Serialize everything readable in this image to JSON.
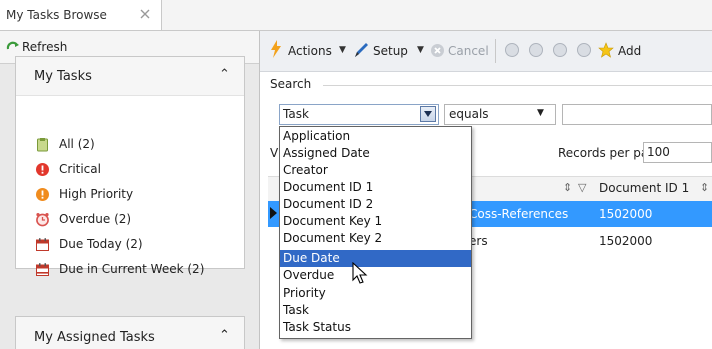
{
  "tab": {
    "title": "My Tasks Browse",
    "close_icon": "close-icon"
  },
  "left_panel": {
    "refresh_label": "Refresh",
    "my_tasks": {
      "title": "My Tasks",
      "collapse_glyph": "˄˄",
      "items": [
        {
          "label": "All (2)",
          "icon": "clipboard-icon",
          "color": "#9bbf5a"
        },
        {
          "label": "Critical",
          "icon": "critical-icon",
          "color": "#e2372c"
        },
        {
          "label": "High Priority",
          "icon": "high-priority-icon",
          "color": "#f08c1e"
        },
        {
          "label": "Overdue (2)",
          "icon": "alarm-clock-icon",
          "color": "#d9534f"
        },
        {
          "label": "Due Today (2)",
          "icon": "calendar-icon",
          "color": "#c0392b"
        },
        {
          "label": "Due in Current Week (2)",
          "icon": "calendar-week-icon",
          "color": "#c0392b"
        }
      ]
    },
    "my_assigned_tasks": {
      "title": "My Assigned Tasks"
    }
  },
  "toolbar": {
    "actions_label": "Actions",
    "setup_label": "Setup",
    "cancel_label": "Cancel",
    "add_label": "Add"
  },
  "search": {
    "section_label": "Search",
    "field_value": "Task",
    "operator_value": "equals",
    "value": ""
  },
  "view": {
    "stub": "Vi",
    "records_per_page_label": "Records per page:",
    "records_per_page_value": "100"
  },
  "grid": {
    "column_doc1": "Document ID 1",
    "rows": [
      {
        "text": "Coss-References",
        "doc1": "1502000",
        "selected": true
      },
      {
        "text": "ers",
        "doc1": "1502000",
        "selected": false
      }
    ]
  },
  "dropdown": {
    "selected": "Due Date",
    "options": [
      "Application",
      "Assigned Date",
      "Creator",
      "Document ID 1",
      "Document ID 2",
      "Document Key 1",
      "Document Key 2",
      "Due Date",
      "Overdue",
      "Priority",
      "Task",
      "Task Status"
    ]
  },
  "colors": {
    "selection_blue": "#3169c6",
    "row_highlight": "#3399ff"
  }
}
